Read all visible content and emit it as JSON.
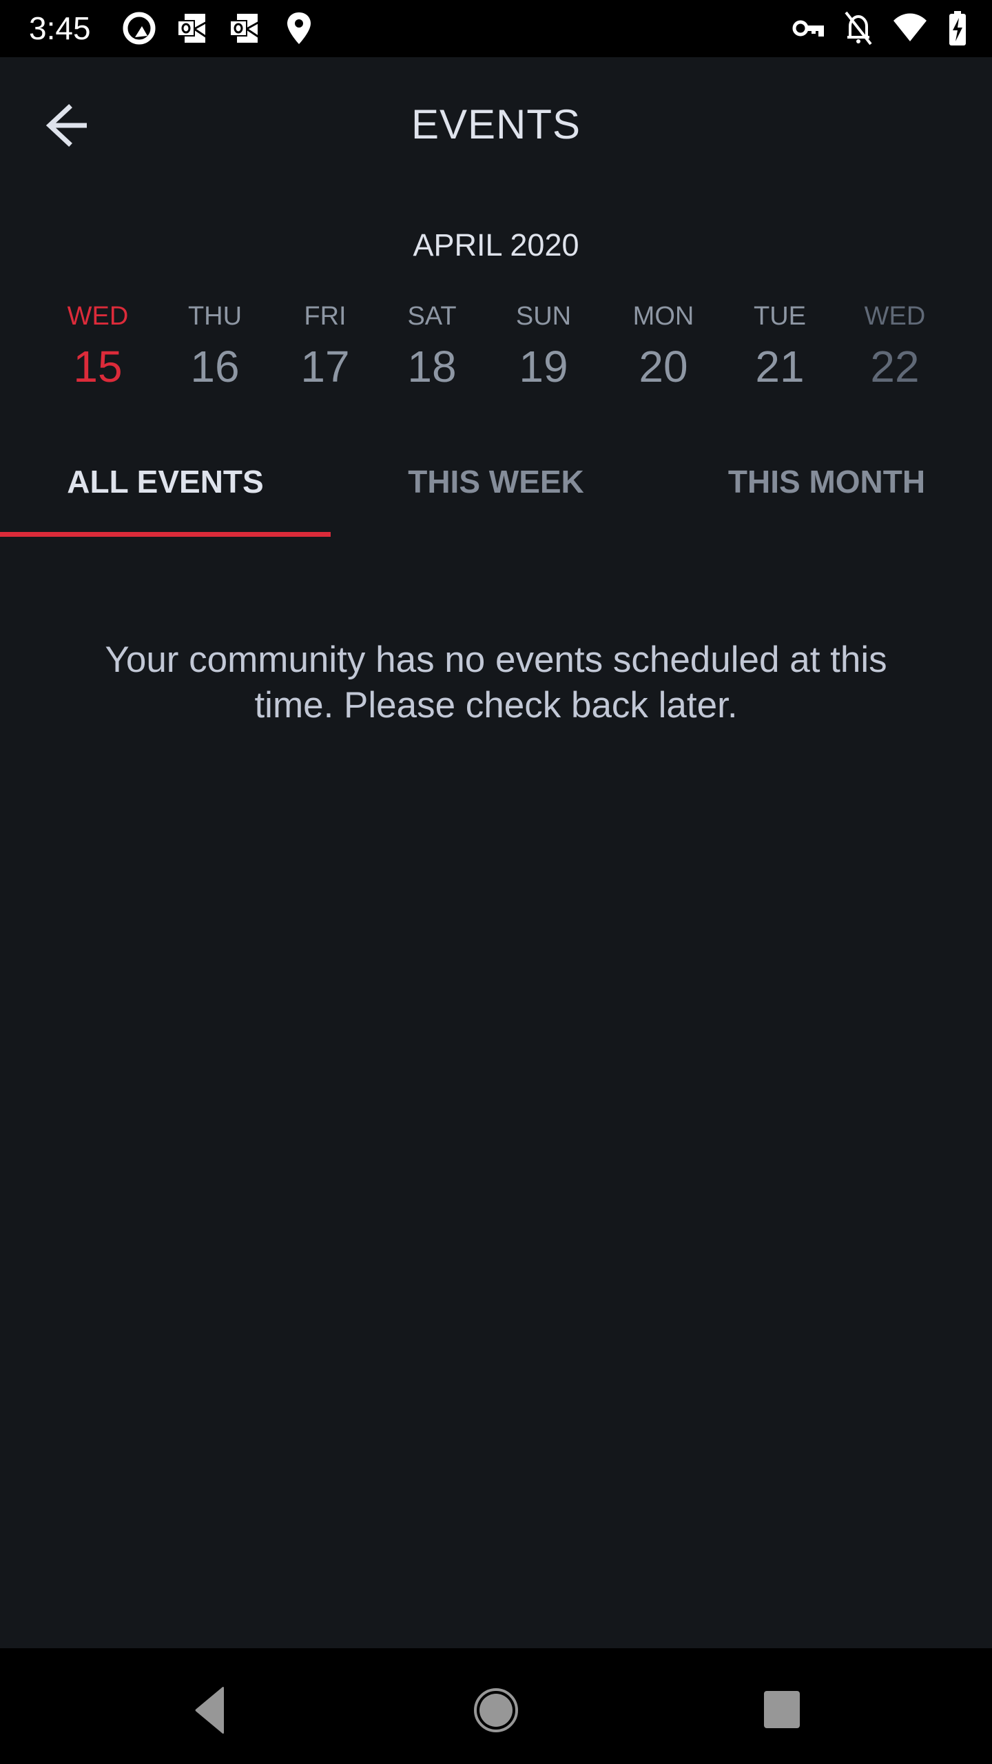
{
  "status_bar": {
    "time": "3:45",
    "left_icons": [
      "q-launcher-icon",
      "outlook-icon",
      "outlook-icon",
      "location-pin-icon"
    ],
    "right_icons": [
      "vpn-key-icon",
      "notifications-off-icon",
      "wifi-icon",
      "battery-charging-icon"
    ]
  },
  "header": {
    "back_icon": "arrow-left-icon",
    "title": "EVENTS"
  },
  "calendar": {
    "month_label": "APRIL 2020",
    "days": [
      {
        "dow": "WED",
        "num": "15",
        "state": "selected"
      },
      {
        "dow": "THU",
        "num": "16",
        "state": "normal"
      },
      {
        "dow": "FRI",
        "num": "17",
        "state": "normal"
      },
      {
        "dow": "SAT",
        "num": "18",
        "state": "normal"
      },
      {
        "dow": "SUN",
        "num": "19",
        "state": "normal"
      },
      {
        "dow": "MON",
        "num": "20",
        "state": "normal"
      },
      {
        "dow": "TUE",
        "num": "21",
        "state": "normal"
      },
      {
        "dow": "WED",
        "num": "22",
        "state": "faded"
      }
    ]
  },
  "tabs": [
    {
      "label": "ALL EVENTS",
      "active": true
    },
    {
      "label": "THIS WEEK",
      "active": false
    },
    {
      "label": "THIS MONTH",
      "active": false
    }
  ],
  "empty_state": {
    "message": "Your community has no events scheduled at this time. Please check back later."
  },
  "colors": {
    "accent": "#dc2b3a",
    "background": "#14171b",
    "text_primary": "#dfe3ec",
    "text_secondary": "#8e97a4"
  },
  "nav_bar": {
    "buttons": [
      "back-triangle-icon",
      "home-circle-icon",
      "recents-square-icon"
    ]
  }
}
